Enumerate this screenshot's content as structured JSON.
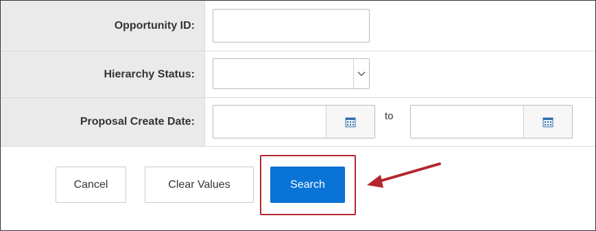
{
  "form": {
    "opportunity_id": {
      "label": "Opportunity ID:",
      "value": ""
    },
    "hierarchy_status": {
      "label": "Hierarchy Status:",
      "selected": ""
    },
    "proposal_create_date": {
      "label": "Proposal Create Date:",
      "from": "",
      "to": "",
      "to_label": "to"
    }
  },
  "actions": {
    "cancel": "Cancel",
    "clear_values": "Clear Values",
    "search": "Search"
  },
  "icons": {
    "dropdown": "chevron-down-icon",
    "calendar": "calendar-icon"
  },
  "colors": {
    "primary_button": "#0a74d6",
    "highlight": "#b3262b",
    "label_background": "#eaeaea",
    "arrow": "#b3262b"
  }
}
